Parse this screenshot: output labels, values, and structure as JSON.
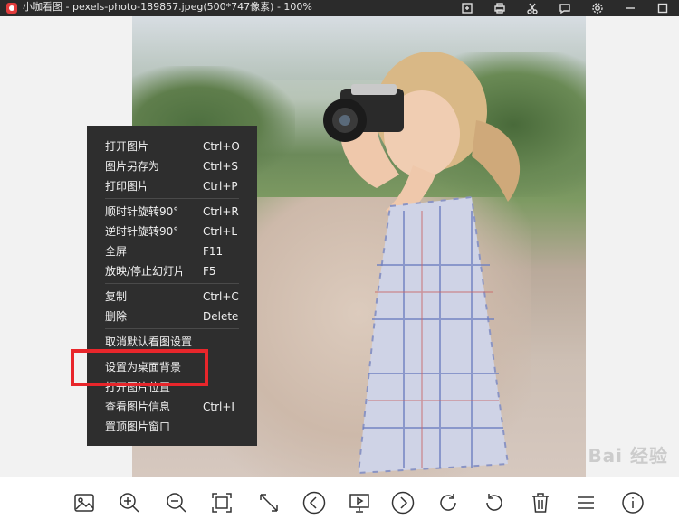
{
  "window": {
    "title": "小咖看图 - pexels-photo-189857.jpeg(500*747像素) - 100%"
  },
  "title_tools": [
    "export-icon",
    "print-icon",
    "scissors-icon",
    "message-icon",
    "gear-icon",
    "minimize-icon",
    "maximize-icon"
  ],
  "context_menu": {
    "groups": [
      [
        {
          "label": "打开图片",
          "shortcut": "Ctrl+O"
        },
        {
          "label": "图片另存为",
          "shortcut": "Ctrl+S"
        },
        {
          "label": "打印图片",
          "shortcut": "Ctrl+P"
        }
      ],
      [
        {
          "label": "顺时针旋转90°",
          "shortcut": "Ctrl+R"
        },
        {
          "label": "逆时针旋转90°",
          "shortcut": "Ctrl+L"
        },
        {
          "label": "全屏",
          "shortcut": "F11"
        },
        {
          "label": "放映/停止幻灯片",
          "shortcut": "F5"
        }
      ],
      [
        {
          "label": "复制",
          "shortcut": "Ctrl+C"
        },
        {
          "label": "删除",
          "shortcut": "Delete"
        }
      ],
      [
        {
          "label": "取消默认看图设置",
          "shortcut": ""
        }
      ],
      [
        {
          "label": "设置为桌面背景",
          "shortcut": ""
        },
        {
          "label": "打开图片位置",
          "shortcut": ""
        },
        {
          "label": "查看图片信息",
          "shortcut": "Ctrl+I"
        },
        {
          "label": "置顶图片窗口",
          "shortcut": ""
        }
      ]
    ]
  },
  "highlight": {
    "target": "设置为桌面背景",
    "color": "#e8262b"
  },
  "toolbar": {
    "buttons": [
      "image-icon",
      "zoom-in-icon",
      "zoom-out-icon",
      "fit-window-icon",
      "actual-size-icon",
      "previous-icon",
      "slideshow-icon",
      "next-icon",
      "rotate-clockwise-icon",
      "rotate-counterclockwise-icon",
      "delete-icon",
      "menu-icon",
      "info-icon"
    ]
  },
  "watermark": "Bai 经验"
}
